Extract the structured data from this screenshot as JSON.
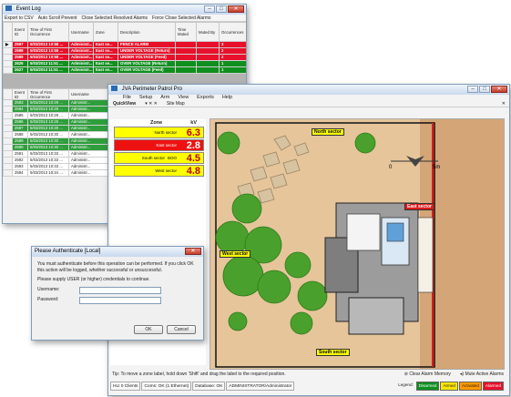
{
  "event_log": {
    "title": "Event Log",
    "menu": [
      "Export to CSV",
      "Auto Scroll Prevent",
      "Close Selected Resolved Alarms",
      "Force Close Selected Alarms"
    ],
    "top_columns": [
      "Event ID",
      "Time of First Occurrence",
      "Username",
      "Zone",
      "Description",
      "Time Muted",
      "Muted By",
      "Occurrences",
      "Time of Latest Occurrence"
    ],
    "top_rows": [
      {
        "style": "red",
        "cells": [
          "2597",
          "5/03/2013 10:58 ...",
          "Administr...",
          "East se...",
          "FENCE ALARM",
          "",
          "",
          "3",
          "5/03/2013 11:53 AM"
        ]
      },
      {
        "style": "red",
        "cells": [
          "2598",
          "5/03/2013 10:58 ...",
          "Administr...",
          "East se...",
          "UNDER VOLTAGE (Return)",
          "",
          "",
          "2",
          "5/03/2013 11:54 AM"
        ]
      },
      {
        "style": "red",
        "cells": [
          "2599",
          "5/03/2013 10:58 ...",
          "Administr...",
          "East se...",
          "UNDER VOLTAGE (Feed)",
          "",
          "",
          "2",
          "5/03/2013 11:54 AM"
        ]
      },
      {
        "style": "green",
        "cells": [
          "2626",
          "5/03/2013 11:51 ...",
          "Administr...",
          "East se...",
          "OVER VOLTAGE (Return)",
          "",
          "",
          "1",
          ""
        ]
      },
      {
        "style": "green",
        "cells": [
          "2627",
          "5/03/2013 11:51 ...",
          "Administr...",
          "East se...",
          "OVER VOLTAGE (Feed)",
          "",
          "",
          "1",
          ""
        ]
      }
    ],
    "bottom_columns": [
      "Event ID",
      "Time of First Occurrence",
      "Username"
    ],
    "bottom_rows": [
      {
        "style": "lg",
        "cells": [
          "2583",
          "5/03/2013 10:29 ...",
          "Administr..."
        ]
      },
      {
        "style": "lg",
        "cells": [
          "2584",
          "5/03/2013 10:29 ...",
          "Administr..."
        ]
      },
      {
        "style": "wh",
        "cells": [
          "2585",
          "5/03/2013 10:29 ...",
          "Administr..."
        ]
      },
      {
        "style": "lg",
        "cells": [
          "2586",
          "5/03/2013 10:29 ...",
          "Administr..."
        ]
      },
      {
        "style": "lg",
        "cells": [
          "2587",
          "5/03/2013 10:29 ...",
          "Administr..."
        ]
      },
      {
        "style": "wh",
        "cells": [
          "2588",
          "5/03/2013 10:30 ...",
          "Administr..."
        ]
      },
      {
        "style": "lg",
        "cells": [
          "2589",
          "5/03/2013 10:30 ...",
          "Administr..."
        ]
      },
      {
        "style": "lg",
        "cells": [
          "2590",
          "5/03/2013 10:30 ...",
          "Administr..."
        ]
      },
      {
        "style": "wh",
        "cells": [
          "2591",
          "5/03/2013 10:33 ...",
          "Administr..."
        ]
      },
      {
        "style": "wh",
        "cells": [
          "2592",
          "5/03/2013 10:33 ...",
          "Administr..."
        ]
      },
      {
        "style": "wh",
        "cells": [
          "2593",
          "5/03/2013 10:33 ...",
          "Administr..."
        ]
      },
      {
        "style": "wh",
        "cells": [
          "2594",
          "5/03/2013 10:34 ...",
          "Administr..."
        ]
      }
    ]
  },
  "main": {
    "title": "JVA Perimeter Patrol Pro",
    "menu": [
      "File",
      "Setup",
      "Arm",
      "View",
      "Exports",
      "Help"
    ],
    "toolbar": {
      "quickview": "QuickView",
      "sitemap": "Site Map",
      "pin": "▾ ✕ ✕"
    },
    "zone_header": {
      "zone": "Zone",
      "kv": "kV"
    },
    "zones": [
      {
        "name": "North sector",
        "value": "6.3",
        "state": "yellow"
      },
      {
        "name": "East sector",
        "value": "2.8",
        "state": "red"
      },
      {
        "name": "South sector",
        "extra": "BOO",
        "value": "4.5",
        "state": "yellow"
      },
      {
        "name": "West sector",
        "value": "4.8",
        "state": "yellow"
      }
    ],
    "map_labels": {
      "north": "North sector",
      "east": "East sector",
      "west": "West sector",
      "south": "South sector",
      "scale_start": "0",
      "scale_end": "5m"
    },
    "tip": "Tip: To move a zone label, hold down 'Shift' and drag the label to the required position.",
    "clear_alarm": "Clear Alarm Memory",
    "mute_alarms": "Mute Active Alarms",
    "status": [
      "HLI 0 Clients",
      "Coms: OK (1 Ethernet)",
      "Database: OK",
      "ADMINISTRATOR/Administrator"
    ],
    "legend_label": "Legend:",
    "legend": [
      "Disarmed",
      "Armed",
      "Activated",
      "Alarmed"
    ]
  },
  "auth": {
    "title": "Please Authenticate [Local]",
    "message": "You must authenticate before this operation can be performed. If you click OK this action will be logged, whether successful or unsuccessful.",
    "prompt": "Please supply USER (or higher) credentials to continue.",
    "username_label": "Username:",
    "password_label": "Password:",
    "ok": "OK",
    "cancel": "Cancel"
  }
}
